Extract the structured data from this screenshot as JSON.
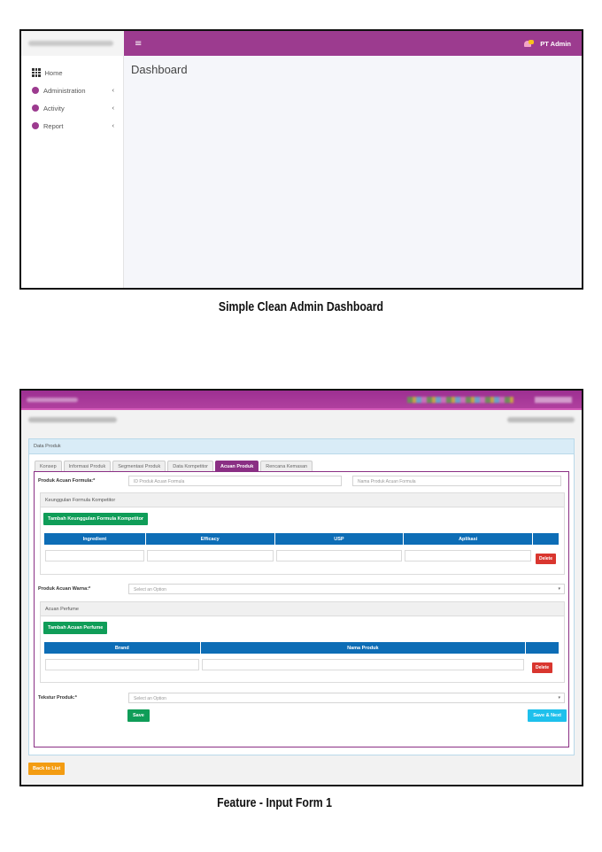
{
  "dashboard": {
    "topbar": {
      "menu_icon": "≡",
      "user": "PT Admin"
    },
    "sidebar": {
      "items": [
        {
          "label": "Home",
          "icon": "grid-icon"
        },
        {
          "label": "Administration",
          "icon": "dot-icon",
          "chevron": "‹"
        },
        {
          "label": "Activity",
          "icon": "dot-icon",
          "chevron": "‹"
        },
        {
          "label": "Report",
          "icon": "dot-icon",
          "chevron": "‹"
        }
      ]
    },
    "page_title": "Dashboard",
    "colors": {
      "accent": "#9c3b8f"
    }
  },
  "caption1": "Simple Clean Admin Dashboard",
  "form": {
    "panel_title": "Data Produk",
    "tabs": [
      "Konsep",
      "Informasi Produk",
      "Segmentasi Produk",
      "Data Kompetitor",
      "Acuan Produk",
      "Rencana Kemasan"
    ],
    "active_tab": "Acuan Produk",
    "produk_acuan_formula": {
      "label": "Produk Acuan Formula:*",
      "id_placeholder": "ID Produk Acuan Formula",
      "name_placeholder": "Nama Produk Acuan Formula"
    },
    "keunggulan": {
      "title": "Keunggulan Formula Kompetitor",
      "add_button": "Tambah Keunggulan Formula Kompetitor",
      "columns": [
        "Ingredient",
        "Efficacy",
        "USP",
        "Aplikasi"
      ],
      "delete_label": "Delete"
    },
    "produk_acuan_warna": {
      "label": "Produk Acuan Warna:*",
      "placeholder": "Select an Option"
    },
    "acuan_perfume": {
      "title": "Acuan Perfume",
      "add_button": "Tambah Acuan Perfume",
      "columns": [
        "Brand",
        "Nama Produk"
      ],
      "delete_label": "Delete"
    },
    "tekstur_produk": {
      "label": "Tekstur Produk:*",
      "placeholder": "Select an Option"
    },
    "save_label": "Save",
    "save_next_label": "Save & Next",
    "back_label": "Back to List"
  },
  "caption2": "Feature - Input Form 1"
}
